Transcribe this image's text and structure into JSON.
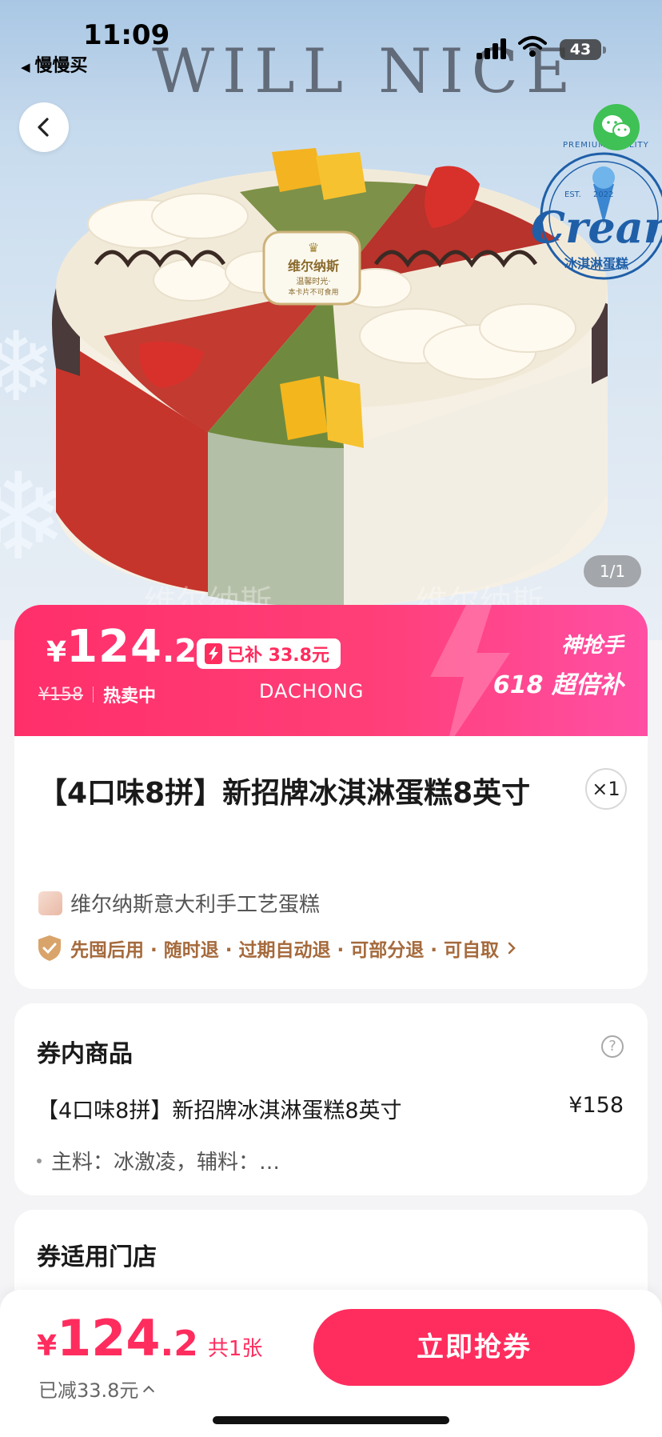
{
  "status_bar": {
    "time": "11:09",
    "back_app": "慢慢买",
    "battery": "43"
  },
  "hero": {
    "brand_banner": "WILL NICE",
    "watermark_text": "维尔纳斯",
    "cake_tag_line1": "维尔纳斯",
    "cake_tag_line2": "温馨时光·",
    "cake_tag_line3": "本卡片不可食用",
    "page_indicator": "1/1",
    "stamp": {
      "top": "PREMIUM QUALITY",
      "est": "EST.",
      "year": "2022",
      "word": "Cream",
      "sub": "冰淇淋蛋糕"
    }
  },
  "price_banner": {
    "currency": "¥",
    "price_int": "124",
    "price_dec": ".2",
    "subsidy": "已补 33.8元",
    "original_price": "¥158",
    "hot_label": "热卖中",
    "watermark": "DACHONG",
    "promo_line1": "神抢手",
    "promo_line2": "618 超倍补"
  },
  "product": {
    "title": "【4口味8拼】新招牌冰淇淋蛋糕8英寸",
    "quantity": "×1",
    "store_name": "维尔纳斯意大利手工艺蛋糕",
    "guarantees": "先囤后用 · 随时退 · 过期自动退 · 可部分退 · 可自取"
  },
  "voucher_items": {
    "section_title": "券内商品",
    "item_name": "【4口味8拼】新招牌冰淇淋蛋糕8英寸",
    "item_price": "¥158",
    "item_detail": "主料：冰激凌，辅料：…"
  },
  "stores": {
    "section_title": "券适用门店"
  },
  "bottom_bar": {
    "currency": "¥",
    "price_int": "124",
    "price_dec": ".2",
    "count": "共1张",
    "saved": "已减33.8元",
    "buy_label": "立即抢券"
  },
  "colors": {
    "accent": "#ff2d5e",
    "guarantee": "#a56a3c",
    "wechat": "#3fc155"
  },
  "icons": [
    "back-chevron-icon",
    "wechat-share-icon",
    "shield-check-icon",
    "help-icon",
    "chevron-right-icon",
    "chevron-up-icon",
    "flash-icon",
    "lightning-bolt-icon"
  ]
}
